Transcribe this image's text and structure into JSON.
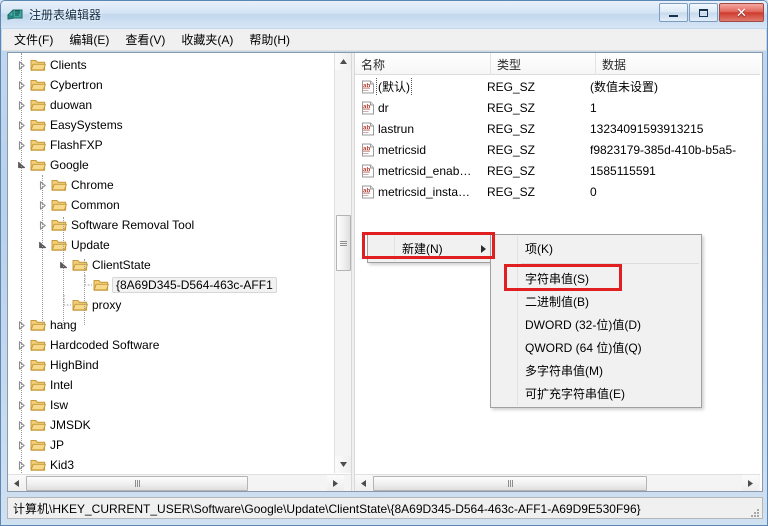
{
  "window": {
    "title": "注册表编辑器",
    "icon": "regedit-icon",
    "controls": {
      "minimize": "最小化",
      "maximize": "最大化",
      "close": "关闭"
    }
  },
  "menubar": [
    {
      "label": "文件(F)"
    },
    {
      "label": "编辑(E)"
    },
    {
      "label": "查看(V)"
    },
    {
      "label": "收藏夹(A)"
    },
    {
      "label": "帮助(H)"
    }
  ],
  "tree": {
    "items": [
      {
        "label": "Clients",
        "depth": 1,
        "state": "collapsed",
        "selected": false
      },
      {
        "label": "Cybertron",
        "depth": 1,
        "state": "collapsed",
        "selected": false
      },
      {
        "label": "duowan",
        "depth": 1,
        "state": "collapsed",
        "selected": false
      },
      {
        "label": "EasySystems",
        "depth": 1,
        "state": "collapsed",
        "selected": false
      },
      {
        "label": "FlashFXP",
        "depth": 1,
        "state": "collapsed",
        "selected": false
      },
      {
        "label": "Google",
        "depth": 1,
        "state": "expanded",
        "selected": false
      },
      {
        "label": "Chrome",
        "depth": 2,
        "state": "collapsed",
        "selected": false
      },
      {
        "label": "Common",
        "depth": 2,
        "state": "collapsed",
        "selected": false
      },
      {
        "label": "Software Removal Tool",
        "depth": 2,
        "state": "collapsed",
        "selected": false
      },
      {
        "label": "Update",
        "depth": 2,
        "state": "expanded",
        "selected": false
      },
      {
        "label": "ClientState",
        "depth": 3,
        "state": "expanded",
        "selected": false
      },
      {
        "label": "{8A69D345-D564-463c-AFF1",
        "depth": 4,
        "state": "leaf",
        "selected": true
      },
      {
        "label": "proxy",
        "depth": 3,
        "state": "leaf",
        "selected": false
      },
      {
        "label": "hang",
        "depth": 1,
        "state": "collapsed",
        "selected": false
      },
      {
        "label": "Hardcoded Software",
        "depth": 1,
        "state": "collapsed",
        "selected": false
      },
      {
        "label": "HighBind",
        "depth": 1,
        "state": "collapsed",
        "selected": false
      },
      {
        "label": "Intel",
        "depth": 1,
        "state": "collapsed",
        "selected": false
      },
      {
        "label": "Isw",
        "depth": 1,
        "state": "collapsed",
        "selected": false
      },
      {
        "label": "JMSDK",
        "depth": 1,
        "state": "collapsed",
        "selected": false
      },
      {
        "label": "JP",
        "depth": 1,
        "state": "collapsed",
        "selected": false
      },
      {
        "label": "Kid3",
        "depth": 1,
        "state": "collapsed",
        "selected": false
      }
    ]
  },
  "listview": {
    "columns": [
      {
        "label": "名称"
      },
      {
        "label": "类型"
      },
      {
        "label": "数据"
      }
    ],
    "rows": [
      {
        "name": "(默认)",
        "type": "REG_SZ",
        "data": "(数值未设置)",
        "focused": true
      },
      {
        "name": "dr",
        "type": "REG_SZ",
        "data": "1",
        "focused": false
      },
      {
        "name": "lastrun",
        "type": "REG_SZ",
        "data": "13234091593913215",
        "focused": false
      },
      {
        "name": "metricsid",
        "type": "REG_SZ",
        "data": "f9823179-385d-410b-b5a5-",
        "focused": false
      },
      {
        "name": "metricsid_enab…",
        "type": "REG_SZ",
        "data": "1585115591",
        "focused": false
      },
      {
        "name": "metricsid_insta…",
        "type": "REG_SZ",
        "data": "0",
        "focused": false
      }
    ]
  },
  "context_menu": {
    "parent": {
      "items": [
        {
          "label": "新建(N)",
          "has_submenu": true,
          "highlighted": true
        }
      ]
    },
    "submenu": {
      "items": [
        {
          "label": "项(K)",
          "separator_after": true,
          "highlighted": false
        },
        {
          "label": "字符串值(S)",
          "separator_after": false,
          "highlighted": true
        },
        {
          "label": "二进制值(B)",
          "separator_after": false,
          "highlighted": false
        },
        {
          "label": "DWORD (32-位)值(D)",
          "separator_after": false,
          "highlighted": false
        },
        {
          "label": "QWORD (64 位)值(Q)",
          "separator_after": false,
          "highlighted": false
        },
        {
          "label": "多字符串值(M)",
          "separator_after": false,
          "highlighted": false
        },
        {
          "label": "可扩充字符串值(E)",
          "separator_after": false,
          "highlighted": false
        }
      ]
    }
  },
  "statusbar": {
    "path": "计算机\\HKEY_CURRENT_USER\\Software\\Google\\Update\\ClientState\\{8A69D345-D564-463c-AFF1-A69D9E530F96}"
  },
  "colors": {
    "annotation": "#e02020",
    "title_text": "#0c2a47",
    "close_button": "#cf3b2e",
    "folder": "#f5cc6a",
    "reg_sz_icon": "#c0392b"
  }
}
